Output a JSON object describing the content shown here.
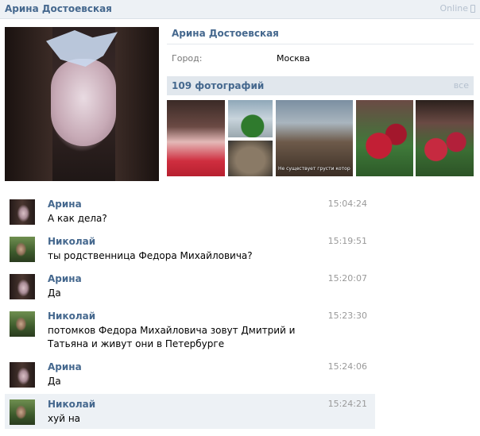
{
  "header": {
    "name": "Арина Достоевская",
    "status": "Online",
    "status_icon": "mobile-phone-icon"
  },
  "profile": {
    "name": "Арина Достоевская",
    "city_label": "Город:",
    "city_value": "Москва"
  },
  "photos": {
    "count_label": "109 фотографий",
    "all_label": "все",
    "thumb4_caption": "Не существует грусти котор нельзя изменить завтраком"
  },
  "messages": [
    {
      "author": "Арина",
      "time": "15:04:24",
      "text": "А как дела?"
    },
    {
      "author": "Николай",
      "time": "15:19:51",
      "text": "ты родственница Федора Михайловича?"
    },
    {
      "author": "Арина",
      "time": "15:20:07",
      "text": "Да"
    },
    {
      "author": "Николай",
      "time": "15:23:30",
      "text": "потомков Федора Михайловича зовут Дмитрий и Татьяна и живут они в Петербурге"
    },
    {
      "author": "Арина",
      "time": "15:24:06",
      "text": "Да"
    },
    {
      "author": "Николай",
      "time": "15:24:21",
      "text": "хуй на"
    }
  ],
  "colors": {
    "accent": "#45688e",
    "header_bg": "#edf1f5",
    "highlight_bg": "#edf1f5"
  }
}
